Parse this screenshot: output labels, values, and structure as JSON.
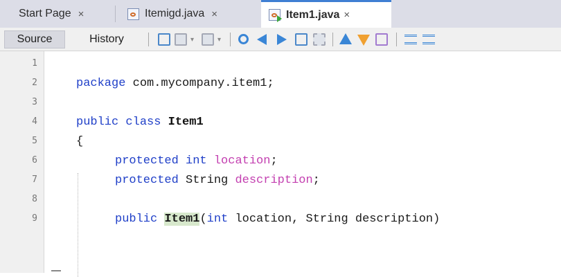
{
  "tabs": [
    {
      "label": "Start Page",
      "close": "×",
      "active": false,
      "icon": null
    },
    {
      "label": "Itemigd.java",
      "close": "×",
      "active": false,
      "icon": "java-file-icon"
    },
    {
      "label": "Item1.java",
      "close": "×",
      "active": true,
      "icon": "java-run-file-icon"
    }
  ],
  "toolbar": {
    "source_label": "Source",
    "history_label": "History",
    "icons": [
      "last-edit-icon",
      "back-icon",
      "forward-icon",
      "find-selection-icon",
      "find-previous-icon",
      "find-next-icon",
      "toggle-highlight-icon",
      "toggle-rectangular-selection-icon",
      "previous-bookmark-icon",
      "next-bookmark-icon",
      "toggle-bookmark-icon",
      "shift-left-icon",
      "shift-right-icon"
    ]
  },
  "editor": {
    "line_numbers": [
      "1",
      "2",
      "3",
      "4",
      "5",
      "6",
      "7",
      "8",
      "9"
    ],
    "lines": {
      "l2": {
        "kw": "package",
        "rest": " com.mycompany.item1;"
      },
      "l4": {
        "kw1": "public",
        "kw2": "class",
        "name": "Item1"
      },
      "l5": {
        "text": "{"
      },
      "l6": {
        "kw1": "protected",
        "kw2": "int",
        "field": "location",
        "end": ";"
      },
      "l7": {
        "kw1": "protected",
        "type": "String",
        "field": "description",
        "end": ";"
      },
      "l9": {
        "kw1": "public",
        "name": "Item1",
        "open": "(",
        "kw2": "int",
        "p1": " location, ",
        "type": "String",
        "p2": " description)"
      }
    }
  },
  "colors": {
    "keyword": "#1f3fc8",
    "field": "#c33fb0",
    "highlight": "#d7e8cc",
    "active_tab_border": "#3f7fd3"
  }
}
